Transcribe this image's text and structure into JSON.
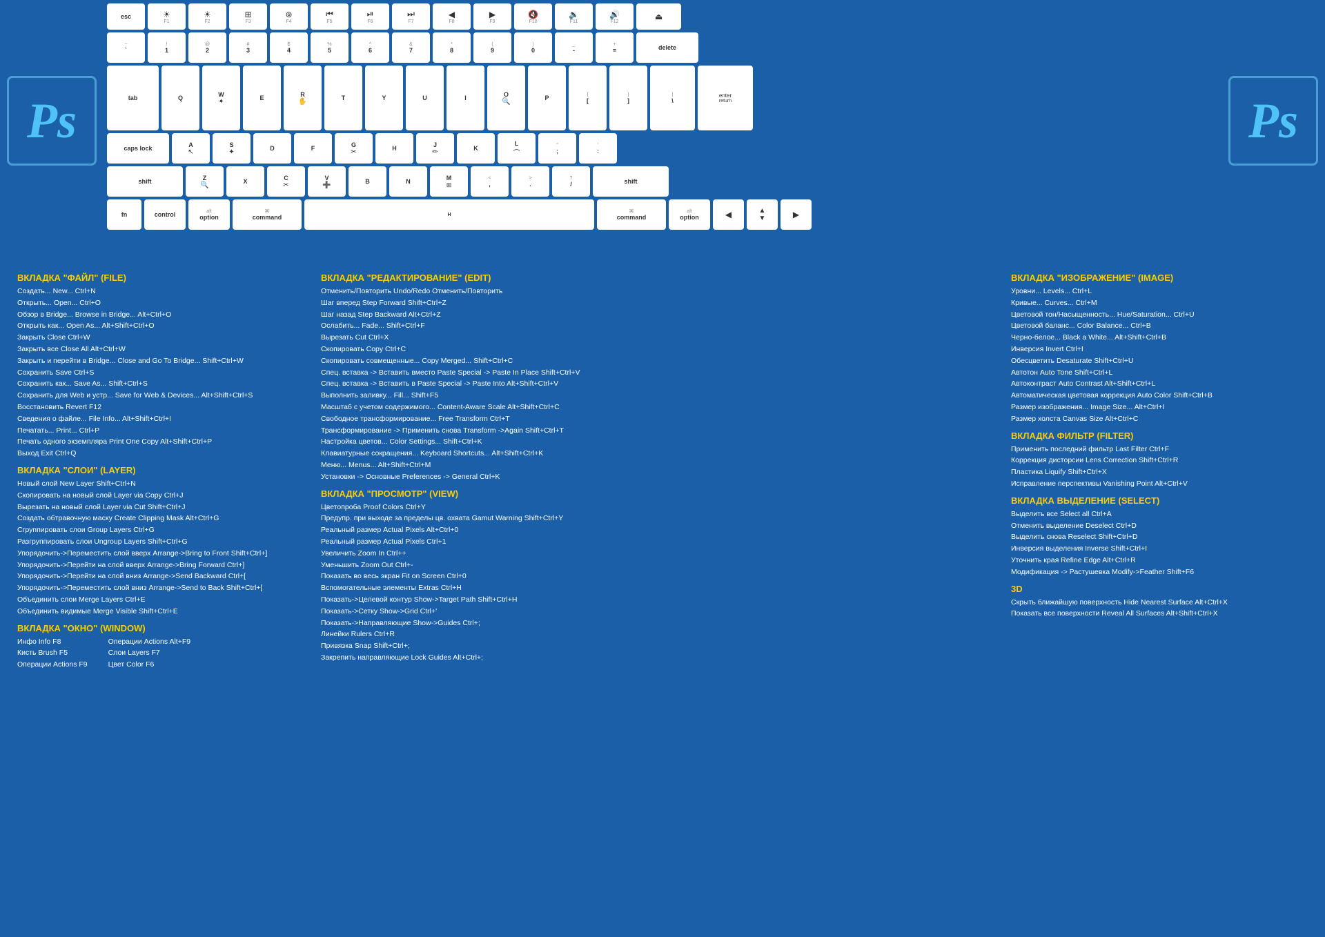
{
  "keyboard": {
    "rows": {
      "func": [
        "esc",
        "☀",
        "☀",
        "⊞",
        "⊚",
        "❮❮",
        "▶⏸",
        "❯❯",
        "◂",
        "▸",
        "🔇",
        "🔉",
        "🔊",
        "⏏"
      ],
      "num": [
        "~\n`",
        "!\n1",
        "@\n2",
        "#\n3",
        "$\n4",
        "%\n5",
        "^\n6",
        "&\n7",
        "*\n8",
        "(\n9",
        ")\n0",
        "-\n_",
        "=\n+",
        "delete"
      ],
      "qwerty": [
        "tab",
        "Q",
        "W",
        "E",
        "R",
        "T",
        "Y",
        "U",
        "I",
        "O",
        "P",
        "[\n{",
        "]\n}",
        "\\"
      ],
      "asdf": [
        "caps lock",
        "A",
        "S",
        "D",
        "F",
        "G",
        "H",
        "J",
        "K",
        "L",
        ";\n:",
        "'\n\"",
        "enter"
      ],
      "zxcv": [
        "shift",
        "Z",
        "X",
        "C",
        "V",
        "B",
        "N",
        "M",
        "<\n,",
        ">\n.",
        "/\n?",
        "shift"
      ],
      "bottom": [
        "fn",
        "control",
        "option",
        "command",
        "",
        "command",
        "option",
        "◂",
        "▼",
        "▸"
      ]
    }
  },
  "logos": {
    "left": "Ps",
    "right": "Ps"
  },
  "sections": {
    "file": {
      "title": "ВКЛАДКА \"ФАЙЛ\" (FILE)",
      "items": [
        "Создать...  New...   Ctrl+N",
        "Открыть...   Open...   Ctrl+O",
        "Обзор в Bridge...  Browse in Bridge...  Alt+Ctrl+O",
        "Открыть как...  Open As...  Alt+Shift+Ctrl+O",
        "Закрыть   Close   Ctrl+W",
        "Закрыть все  Close All   Alt+Ctrl+W",
        "Закрыть и перейти в Bridge...  Close and Go To Bridge...   Shift+Ctrl+W",
        "Сохранить  Save   Ctrl+S",
        "Сохранить как...   Save As...   Shift+Ctrl+S",
        "Сохранить для Web и устр...  Save for Web & Devices...   Alt+Shift+Ctrl+S",
        "Восстановить  Revert  F12",
        "Сведения о файле...  File Info...  Alt+Shift+Ctrl+I",
        "Печатать...   Print...   Ctrl+P",
        "Печать одного экземпляра  Print One Copy  Alt+Shift+Ctrl+P",
        "Выход  Exit  Ctrl+Q"
      ]
    },
    "layer": {
      "title": "ВКЛАДКА \"СЛОИ\" (LAYER)",
      "items": [
        "Новый слой  New Layer    Shift+Ctrl+N",
        "Скопировать на новый слой  Layer via Copy  Ctrl+J",
        "Вырезать на новый слой  Layer via Cut  Shift+Ctrl+J",
        "Создать обтравочную маску  Create Clipping Mask  Alt+Ctrl+G",
        "Сгруппировать слои  Group Layers    Ctrl+G",
        "Разгруппировать слои  Ungroup Layers  Shift+Ctrl+G",
        "Упорядочить->Переместить слой вверх  Arrange->Bring to Front  Shift+Ctrl+]",
        "Упорядочить->Перейти на слой вверх   Arrange->Bring Forward  Ctrl+]",
        "Упорядочить->Перейти на слой вниз  Arrange->Send Backward   Ctrl+[",
        "Упорядочить->Переместить слой вниз  Arrange->Send to Back  Shift+Ctrl+[",
        "Объединить слои  Merge Layers   Ctrl+E",
        "Объединить видимые   Merge Visible  Shift+Ctrl+E"
      ]
    },
    "window": {
      "title": "ВКЛАДКА \"ОКНО\" (WINDOW)",
      "col1": [
        "Инфо   Info  F8",
        "Кисть   Brush  F5",
        "Операции  Actions  F9"
      ],
      "col2": [
        "Операции  Actions  Alt+F9",
        "Слои   Layers  F7",
        "Цвет   Color   F6"
      ]
    },
    "edit": {
      "title": "ВКЛАДКА \"РЕДАКТИРОВАНИЕ\" (EDIT)",
      "items": [
        "Отменить/Повторить   Undo/Redo   Отменить/Повторить",
        "Шаг вперед  Step Forward  Shift+Ctrl+Z",
        "Шаг назад   Step Backward  Alt+Ctrl+Z",
        "Ослабить...   Fade...   Shift+Ctrl+F",
        "Вырезать  Cut   Ctrl+X",
        "Скопировать  Copy   Ctrl+C",
        "Скопировать совмещенные...  Copy Merged...  Shift+Ctrl+C",
        "Спец. вставка -> Вставить вместо  Paste Special -> Paste In Place   Shift+Ctrl+V",
        "Спец. вставка -> Вставить в  Paste Special -> Paste Into  Alt+Shift+Ctrl+V",
        "Выполнить заливку...  Fill...  Shift+F5",
        "Масштаб с учетом содержимого...  Content-Aware Scale  Alt+Shift+Ctrl+C",
        "Свободное трансформирование...  Free Transform   Ctrl+T",
        "Трансформирование -> Применить снова  Transform ->Again  Shift+Ctrl+T",
        "Настройка цветов...  Color Settings...  Shift+Ctrl+K",
        "Клавиатурные сокращения...  Keyboard Shortcuts...  Alt+Shift+Ctrl+K",
        "Меню...   Menus...  Alt+Shift+Ctrl+M",
        "Установки -> Основные Preferences -> General   Ctrl+K"
      ]
    },
    "view": {
      "title": "ВКЛАДКА \"ПРОСМОТР\" (VIEW)",
      "items": [
        "Цветопроба  Proof Colors  Ctrl+Y",
        "Предупр. при выходе за пределы цв. охвата  Gamut Warning  Shift+Ctrl+Y",
        "Реальный размер  Actual Pixels  Alt+Ctrl+0",
        "Реальный размер  Actual Pixels  Ctrl+1",
        "Увеличить   Zoom In   Ctrl++",
        "Уменьшить   Zoom Out  Ctrl+-",
        "Показать во весь экран  Fit on Screen  Ctrl+0",
        "Вспомогательные элементы  Extras   Ctrl+H",
        "Показать->Целевой контур   Show->Target Path  Shift+Ctrl+H",
        "Показать->Сетку   Show->Grid   Ctrl+'",
        "Показать->Направляющие   Show->Guides   Ctrl+;",
        "Линейки   Rulers  Ctrl+R",
        "Привязка  Snap   Shift+Ctrl+;",
        "Закрепить направляющие  Lock Guides  Alt+Ctrl+;"
      ]
    },
    "image": {
      "title": "ВКЛАДКА \"ИЗОБРАЖЕНИЕ\" (IMAGE)",
      "items": [
        "Уровни...   Levels...    Ctrl+L",
        "Кривые...   Curves...    Ctrl+M",
        "Цветовой тон/Насыщенность...  Hue/Saturation...    Ctrl+U",
        "Цветовой баланс...   Color Balance...   Ctrl+B",
        "Черно-белое...   Black a White...   Alt+Shift+Ctrl+B",
        "Инверсия  Invert   Ctrl+I",
        "Обесцветить   Desaturate    Shift+Ctrl+U",
        "Автотон   Auto Tone  Shift+Ctrl+L",
        "Автоконтраст   Auto Contrast    Alt+Shift+Ctrl+L",
        "Автоматическая цветовая коррекция  Auto Color  Shift+Ctrl+B",
        "Размер изображения...   Image Size...   Alt+Ctrl+I",
        "Размер холста  Canvas Size  Alt+Ctrl+C"
      ]
    },
    "filter": {
      "title": "ВКЛАДКА ФИЛЬТР (FILTER)",
      "items": [
        "Применить последний фильтр  Last Filter   Ctrl+F",
        "Коррекция дисторсии   Lens Correction  Shift+Ctrl+R",
        "Пластика  Liquify   Shift+Ctrl+X",
        "Исправление перспективы   Vanishing Point  Alt+Ctrl+V"
      ]
    },
    "select": {
      "title": "ВКЛАДКА ВЫДЕЛЕНИЕ (SELECT)",
      "items": [
        "Выделить все   Select all   Ctrl+A",
        "Отменить выделение   Deselect   Ctrl+D",
        "Выделить снова   Reselect    Shift+Ctrl+D",
        "Инверсия выделения   Inverse  Shift+Ctrl+I",
        "Уточнить края   Refine Edge  Alt+Ctrl+R",
        "Модификация -> Растушевка    Modify->Feather    Shift+F6"
      ]
    },
    "3d": {
      "title": "3D",
      "items": [
        "Скрыть ближайшую поверхность  Hide Nearest Surface  Alt+Ctrl+X",
        "Показать все поверхности  Reveal All Surfaces    Alt+Shift+Ctrl+X"
      ]
    }
  }
}
